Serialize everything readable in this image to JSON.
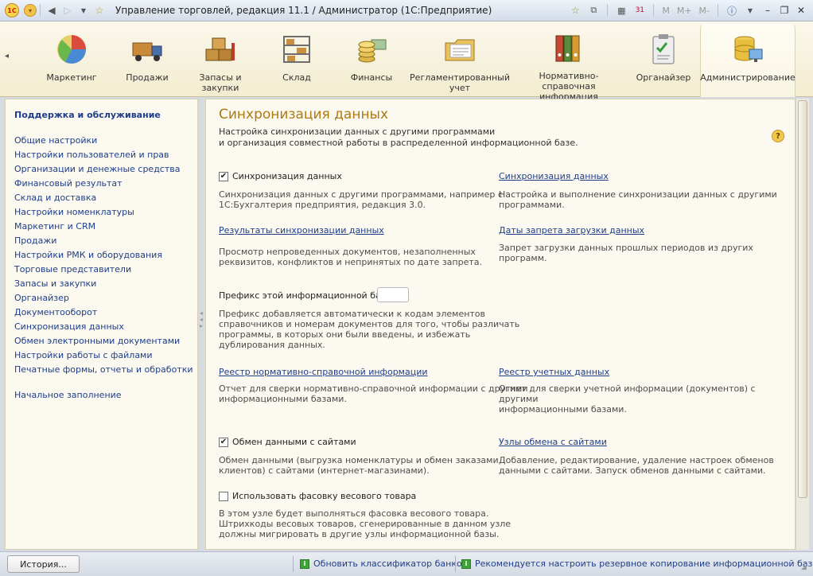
{
  "window": {
    "title": "Управление торговлей, редакция 11.1 / Администратор  (1С:Предприятие)",
    "logo_text": "1С",
    "memory_buttons": [
      "M",
      "M+",
      "M-"
    ]
  },
  "sections": [
    {
      "label": "Маркетинг",
      "icon": "marketing-icon"
    },
    {
      "label": "Продажи",
      "icon": "sales-truck-icon"
    },
    {
      "label": "Запасы и\nзакупки",
      "icon": "stock-boxes-icon"
    },
    {
      "label": "Склад",
      "icon": "warehouse-shelf-icon"
    },
    {
      "label": "Финансы",
      "icon": "finance-coins-icon"
    },
    {
      "label": "Регламентированный\nучет",
      "icon": "accounting-folder-icon"
    },
    {
      "label": "Нормативно-справочная\nинформация",
      "icon": "reference-binders-icon"
    },
    {
      "label": "Органайзер",
      "icon": "organizer-clipboard-icon"
    },
    {
      "label": "Администрирование",
      "icon": "admin-database-icon",
      "active": true
    }
  ],
  "sidebar": {
    "heading": "Поддержка и обслуживание",
    "items": [
      "Общие настройки",
      "Настройки пользователей и прав",
      "Организации и денежные средства",
      "Финансовый результат",
      "Склад и доставка",
      "Настройки номенклатуры",
      "Маркетинг и CRM",
      "Продажи",
      "Настройки РМК и оборудования",
      "Торговые представители",
      "Запасы и закупки",
      "Органайзер",
      "Документооборот",
      "Синхронизация данных",
      "Обмен электронными документами",
      "Настройки работы с файлами",
      "Печатные формы, отчеты и обработки"
    ],
    "extra_item": "Начальное заполнение"
  },
  "main": {
    "title": "Синхронизация данных",
    "description_line1": "Настройка синхронизации данных с другими программами",
    "description_line2": "и организация совместной работы в распределенной информационной базе.",
    "sync_checkbox": {
      "label": "Синхронизация данных",
      "checked": true
    },
    "sync_desc_line1": "Синхронизация данных с другими программами, например с",
    "sync_desc_line2": "1С:Бухгалтерия предприятия, редакция 3.0.",
    "sync_link": "Синхронизация данных",
    "sync_link_desc_line1": "Настройка и выполнение синхронизации данных с другими",
    "sync_link_desc_line2": "программами.",
    "results_link": "Результаты синхронизации данных",
    "results_desc_line1": "Просмотр непроведенных документов, незаполненных",
    "results_desc_line2": "реквизитов, конфликтов и непринятых по дате запрета.",
    "dates_link": "Даты запрета загрузки данных",
    "dates_desc": "Запрет загрузки данных прошлых периодов из других программ.",
    "prefix_label": "Префикс этой информационной базы:",
    "prefix_value": "",
    "prefix_desc_line1": "Префикс добавляется автоматически к кодам элементов",
    "prefix_desc_line2": "справочников и номерам документов для того, чтобы различать",
    "prefix_desc_line3": "программы, в которых они были введены, и избежать",
    "prefix_desc_line4": "дублирования данных.",
    "registry_nsi_link": "Реестр нормативно-справочной информации",
    "registry_nsi_desc_line1": "Отчет для сверки нормативно-справочной информации с другими",
    "registry_nsi_desc_line2": "информационными базами.",
    "registry_acc_link": "Реестр учетных данных",
    "registry_acc_desc_line1": "Отчет для сверки учетной информации (документов) с другими",
    "registry_acc_desc_line2": "информационными базами.",
    "sites_checkbox": {
      "label": "Обмен данными с сайтами",
      "checked": true
    },
    "sites_desc_line1": "Обмен данными (выгрузка номенклатуры и обмен заказами",
    "sites_desc_line2": "клиентов) с сайтами (интернет-магазинами).",
    "sites_link": "Узлы обмена с сайтами",
    "sites_link_desc_line1": "Добавление, редактирование, удаление настроек обменов",
    "sites_link_desc_line2": "данными с сайтами. Запуск обменов данными с сайтами.",
    "weight_checkbox": {
      "label": "Использовать фасовку весового товара",
      "checked": false
    },
    "weight_desc_line1": "В этом узле будет выполняться фасовка весового товара.",
    "weight_desc_line2": "Штрихкоды весовых товаров, сгенерированные в данном узле",
    "weight_desc_line3": "должны мигрировать в другие узлы информационной базы."
  },
  "status": {
    "history_button": "История...",
    "msg1": "Обновить классификатор банков",
    "msg2": "Рекомендуется настроить резервное копирование информационной базы."
  },
  "colors": {
    "link": "#1f3e8a",
    "title": "#b07a12",
    "panel_bg": "#fbf9f0"
  }
}
